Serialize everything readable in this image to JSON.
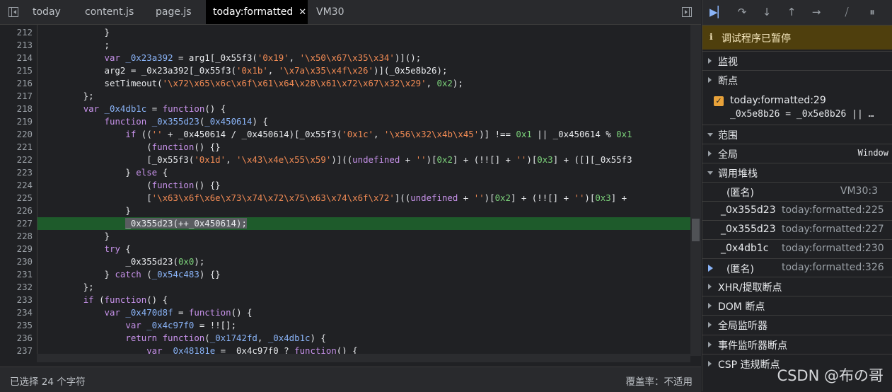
{
  "tabs": [
    {
      "label": "today",
      "active": false
    },
    {
      "label": "content.js",
      "active": false
    },
    {
      "label": "page.js",
      "active": false
    },
    {
      "label": "today:formatted",
      "active": true,
      "close": "✕"
    },
    {
      "label": "VM30",
      "active": false
    }
  ],
  "code": {
    "lines": [
      {
        "n": "212",
        "html": "            }"
      },
      {
        "n": "213",
        "html": "            ;"
      },
      {
        "n": "214",
        "html": "            <span class='k'>var</span> <span class='v'>_0x23a392</span> = arg1[_0x55f3(<span class='s'>'0x19'</span>, <span class='s'>'\\x50\\x67\\x35\\x34'</span>)]();"
      },
      {
        "n": "215",
        "html": "            arg2 = _0x23a392[_0x55f3(<span class='s'>'0x1b'</span>, <span class='s'>'\\x7a\\x35\\x4f\\x26'</span>)](_0x5e8b26);"
      },
      {
        "n": "216",
        "html": "            setTimeout(<span class='s'>'\\x72\\x65\\x6c\\x6f\\x61\\x64\\x28\\x61\\x72\\x67\\x32\\x29'</span>, <span class='n'>0x2</span>);"
      },
      {
        "n": "217",
        "html": "        };"
      },
      {
        "n": "218",
        "html": "        <span class='k'>var</span> <span class='v'>_0x4db1c</span> = <span class='k'>function</span>() {"
      },
      {
        "n": "219",
        "html": "            <span class='k'>function</span> <span class='v'>_0x355d23</span>(<span class='v'>_0x450614</span>) {"
      },
      {
        "n": "220",
        "html": "                <span class='k'>if</span> ((<span class='s'>''</span> + _0x450614 / _0x450614)[_0x55f3(<span class='s'>'0x1c'</span>, <span class='s'>'\\x56\\x32\\x4b\\x45'</span>)] !== <span class='n'>0x1</span> || _0x450614 % <span class='n'>0x1</span>"
      },
      {
        "n": "221",
        "html": "                    (<span class='k'>function</span>() {}"
      },
      {
        "n": "222",
        "html": "                    [_0x55f3(<span class='s'>'0x1d'</span>, <span class='s'>'\\x43\\x4e\\x55\\x59'</span>)]((<span class='k'>undefined</span> + <span class='s'>''</span>)[<span class='n'>0x2</span>] + (!![] + <span class='s'>''</span>)[<span class='n'>0x3</span>] + ([][_0x55f3"
      },
      {
        "n": "223",
        "html": "                } <span class='k'>else</span> {"
      },
      {
        "n": "224",
        "html": "                    (<span class='k'>function</span>() {}"
      },
      {
        "n": "225",
        "html": "                    [<span class='s'>'\\x63\\x6f\\x6e\\x73\\x74\\x72\\x75\\x63\\x74\\x6f\\x72'</span>]((<span class='k'>undefined</span> + <span class='s'>''</span>)[<span class='n'>0x2</span>] + (!![] + <span class='s'>''</span>)[<span class='n'>0x3</span>] +"
      },
      {
        "n": "226",
        "html": "                }"
      },
      {
        "n": "227",
        "html": "                <span class='sel'>_0x355d23(++_0x450614);</span>",
        "highlight": true
      },
      {
        "n": "228",
        "html": "            }"
      },
      {
        "n": "229",
        "html": "            <span class='k'>try</span> {"
      },
      {
        "n": "230",
        "html": "                _0x355d23(<span class='n'>0x0</span>);"
      },
      {
        "n": "231",
        "html": "            } <span class='k'>catch</span> (<span class='v'>_0x54c483</span>) {}"
      },
      {
        "n": "232",
        "html": "        };"
      },
      {
        "n": "233",
        "html": "        <span class='k'>if</span> (<span class='k'>function</span>() {"
      },
      {
        "n": "234",
        "html": "            <span class='k'>var</span> <span class='v'>_0x470d8f</span> = <span class='k'>function</span>() {"
      },
      {
        "n": "235",
        "html": "                <span class='k'>var</span> <span class='v'>_0x4c97f0</span> = !![];"
      },
      {
        "n": "236",
        "html": "                <span class='k'>return</span> <span class='k'>function</span>(<span class='v'>_0x1742fd</span>, <span class='v'>_0x4db1c</span>) {"
      },
      {
        "n": "237",
        "html": "                    <span class='k'>var</span> <span class='v'>_0x48181e</span> = _0x4c97f0 ? <span class='k'>function</span>() {"
      },
      {
        "n": "238",
        "html": ""
      }
    ]
  },
  "status": {
    "selection": "已选择 24 个字符",
    "coverage": "覆盖率：不适用"
  },
  "debugger": {
    "toolbar_icons": [
      "resume-icon",
      "step-over-icon",
      "step-into-icon",
      "step-out-icon",
      "step-icon",
      "deactivate-breakpoints-icon",
      "pause-on-exceptions-icon"
    ],
    "paused_icon": "ℹ",
    "paused": "调试程序已暂停",
    "sections": {
      "watch": "监视",
      "breakpoints": "断点",
      "scope": "范围",
      "global": "全局",
      "global_value": "Window",
      "callstack": "调用堆栈",
      "xhr": "XHR/提取断点",
      "dom": "DOM 断点",
      "global_listeners": "全局监听器",
      "event_listeners": "事件监听器断点",
      "csp": "CSP 违规断点"
    },
    "breakpoint": {
      "title": "today:formatted:29",
      "code": "_0x5e8b26 = _0x5e8b26 || …",
      "checked": true
    },
    "frames": [
      {
        "name": "(匿名)",
        "loc": "VM30:3"
      },
      {
        "name": "_0x355d23",
        "loc": "today:formatted:225"
      },
      {
        "name": "_0x355d23",
        "loc": "today:formatted:227"
      },
      {
        "name": "_0x4db1c",
        "loc": "today:formatted:230"
      },
      {
        "name": "(匿名)",
        "loc": "today:formatted:326",
        "current": true
      }
    ]
  },
  "watermark": "CSDN @布の哥"
}
